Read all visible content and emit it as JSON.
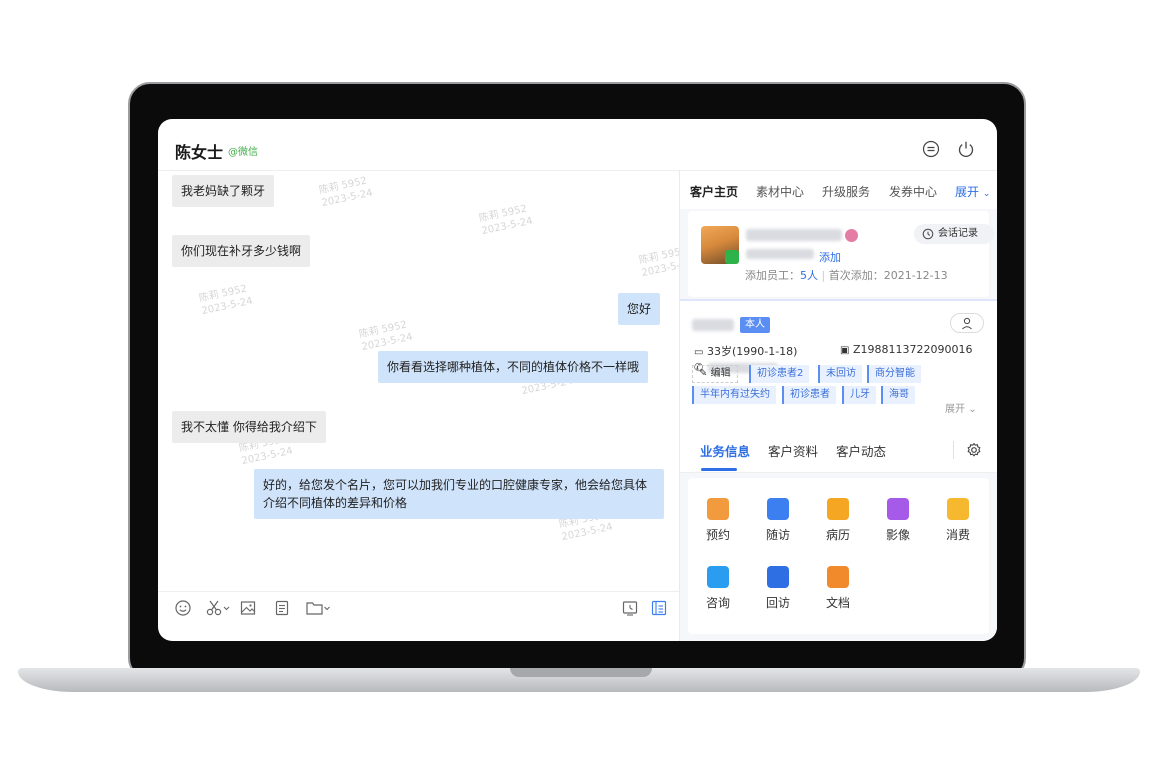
{
  "header": {
    "contact_name": "陈女士",
    "contact_source": "@微信"
  },
  "chat": {
    "messages": [
      {
        "dir": "in",
        "text": "我老妈缺了颗牙"
      },
      {
        "dir": "in",
        "text": "你们现在补牙多少钱啊"
      },
      {
        "dir": "out",
        "text": "您好"
      },
      {
        "dir": "out",
        "text": "你看看选择哪种植体，不同的植体价格不一样哦"
      },
      {
        "dir": "in",
        "text": "我不太懂 你得给我介绍下"
      },
      {
        "dir": "out",
        "text": "好的，给您发个名片，您可以加我们专业的口腔健康专家，他会给您具体介绍不同植体的差异和价格"
      }
    ],
    "watermark": {
      "name": "陈莉 5952",
      "date": "2023-5-24"
    }
  },
  "right_panel": {
    "tabs": [
      "客户主页",
      "素材中心",
      "升级服务",
      "发券中心"
    ],
    "expand_label": "展开",
    "customer": {
      "add_label": "添加",
      "added_staff_label": "添加员工：",
      "added_staff_count": "5人",
      "first_add_label": "首次添加：",
      "first_add_date": "2021-12-13",
      "chat_record_label": "会话记录"
    },
    "patient": {
      "self_tag": "本人",
      "age_birth": "33岁(1990-1-18)",
      "patient_id": "Z1988113722090016",
      "edit_label": "编辑",
      "tags_row1": [
        "初诊患者2",
        "未回访",
        "商分智能"
      ],
      "tags_row2": [
        "半年内有过失约",
        "初诊患者",
        "儿牙",
        "海哥"
      ],
      "expand_label": "展开"
    },
    "biz_tabs": [
      "业务信息",
      "客户资料",
      "客户动态"
    ],
    "grid": [
      {
        "label": "预约",
        "color": "#f19a3e"
      },
      {
        "label": "随访",
        "color": "#3c7ff0"
      },
      {
        "label": "病历",
        "color": "#f5a623"
      },
      {
        "label": "影像",
        "color": "#a55be8"
      },
      {
        "label": "消费",
        "color": "#f5b82e"
      },
      {
        "label": "咨询",
        "color": "#2b9df0"
      },
      {
        "label": "回访",
        "color": "#2f6fe4"
      },
      {
        "label": "文档",
        "color": "#f08a2b"
      }
    ]
  }
}
